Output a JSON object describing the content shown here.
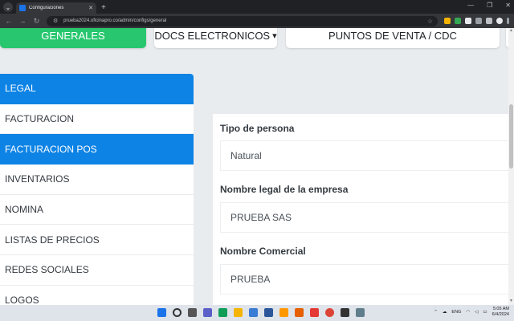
{
  "browser": {
    "tab_title": "Configuraciones",
    "url": "prueba2024.oficinapro.co/admin/configs/general",
    "colors": {
      "chrome_dark": "#202124",
      "chrome_mid": "#35363a"
    }
  },
  "top_buttons": {
    "generales": "GENERALES",
    "docs": "DOCS ELECTRONICOS",
    "docs_caret": "▾",
    "puntos": "PUNTOS DE VENTA / CDC"
  },
  "sidebar": {
    "items": [
      {
        "label": "LEGAL",
        "active": true
      },
      {
        "label": "FACTURACION",
        "active": false
      },
      {
        "label": "FACTURACION POS",
        "active": true
      },
      {
        "label": "INVENTARIOS",
        "active": false
      },
      {
        "label": "NOMINA",
        "active": false
      },
      {
        "label": "LISTAS DE PRECIOS",
        "active": false
      },
      {
        "label": "REDES SOCIALES",
        "active": false
      },
      {
        "label": "LOGOS",
        "active": false
      }
    ]
  },
  "form": {
    "tipo_label": "Tipo de persona",
    "tipo_value": "Natural",
    "nombre_legal_label": "Nombre legal de la empresa",
    "nombre_legal_value": "PRUEBA SAS",
    "nombre_comercial_label": "Nombre Comercial",
    "nombre_comercial_value": "PRUEBA"
  },
  "taskbar": {
    "lang": "ENG",
    "time": "5:05 AM",
    "date": "6/4/2024"
  },
  "colors": {
    "success": "#28c76f",
    "primary": "#0d83e5",
    "background": "#e9ecef"
  }
}
